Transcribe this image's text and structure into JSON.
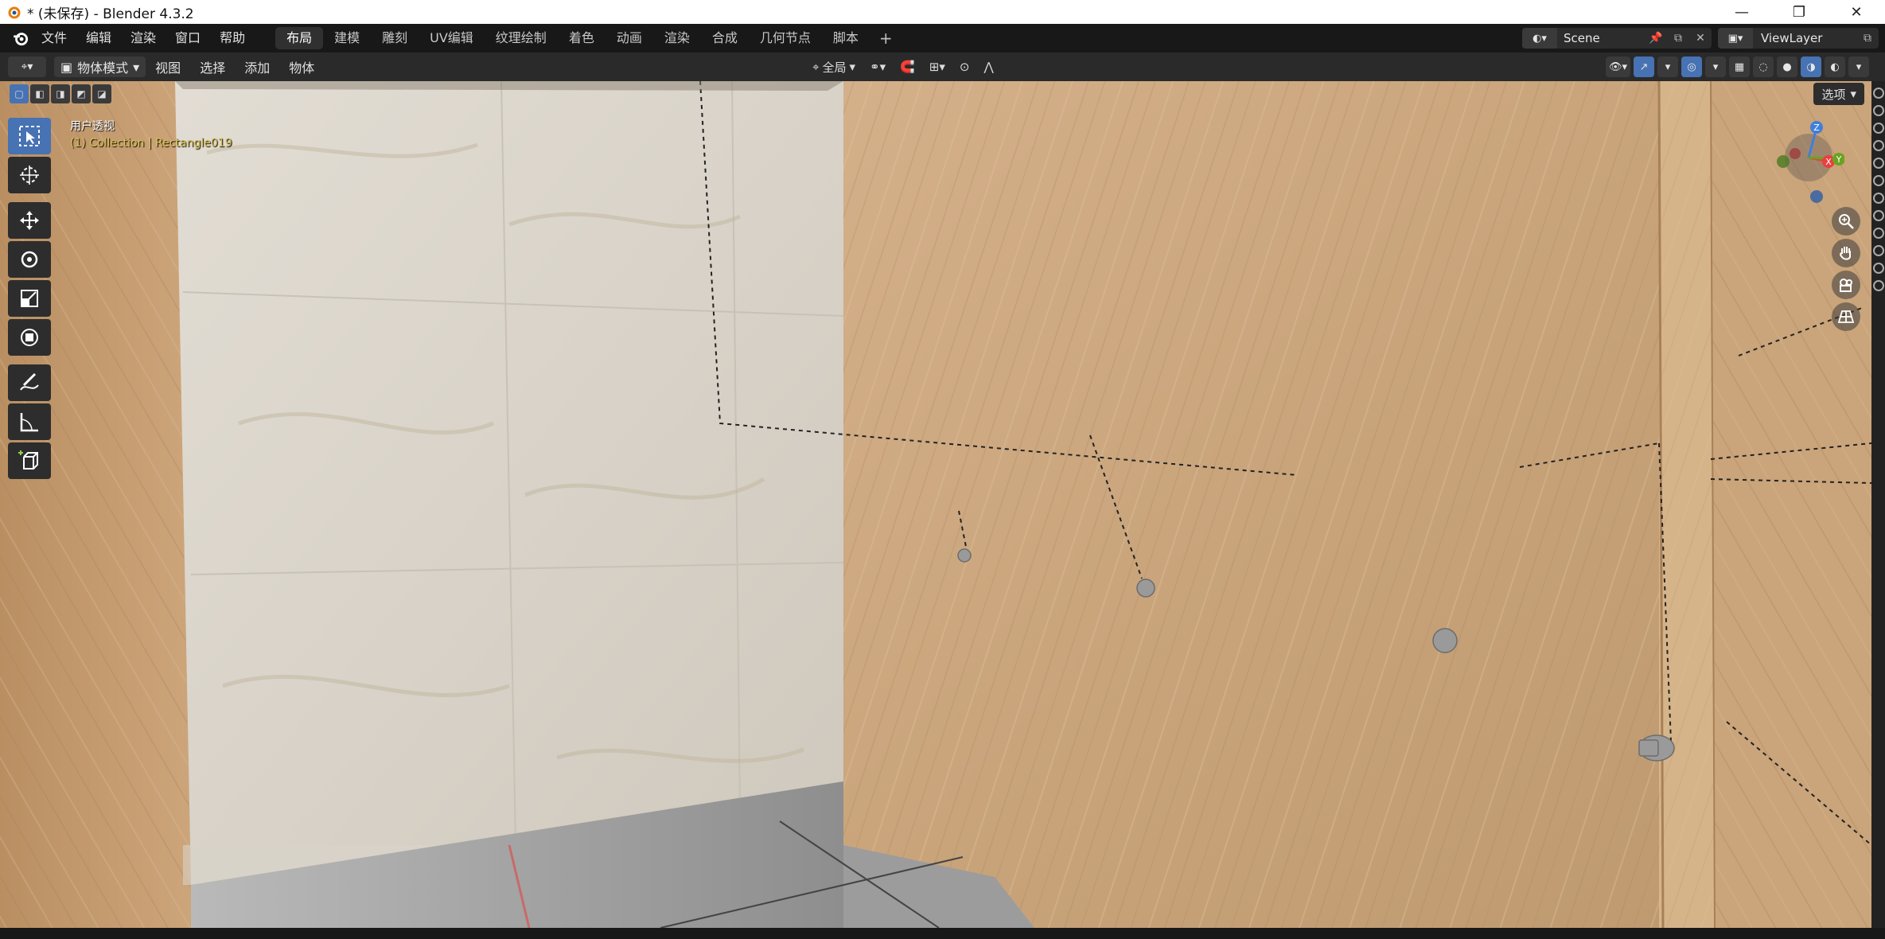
{
  "window": {
    "title": "* (未保存) - Blender 4.3.2",
    "controls": [
      "minimize",
      "restore",
      "close"
    ]
  },
  "menubar": {
    "items": [
      "文件",
      "编辑",
      "渲染",
      "窗口",
      "帮助"
    ],
    "workspaces": [
      "布局",
      "建模",
      "雕刻",
      "UV编辑",
      "纹理绘制",
      "着色",
      "动画",
      "渲染",
      "合成",
      "几何节点",
      "脚本"
    ],
    "active_workspace": "布局",
    "add_label": "+",
    "scene_name": "Scene",
    "view_layer_name": "ViewLayer"
  },
  "viewport_header": {
    "mode": "物体模式",
    "menus": [
      "视图",
      "选择",
      "添加",
      "物体"
    ],
    "transform_orientation": "全局",
    "options_label": "选项"
  },
  "viewport": {
    "view_name": "用户透视",
    "collection_info": "(1) Collection | Rectangle019"
  },
  "toolbar": {
    "tools": [
      "select-box",
      "cursor",
      "move",
      "rotate",
      "scale",
      "transform",
      "annotate",
      "measure",
      "add-cube"
    ],
    "active": "select-box"
  },
  "gizmo": {
    "axes": [
      "Z",
      "X",
      "Y"
    ],
    "colors": {
      "x": "#e8413d",
      "y": "#6aa320",
      "z": "#3f7fd9"
    }
  },
  "colors": {
    "accent": "#4772b3",
    "wood": "#c9a47b",
    "marble": "#dcd6cc"
  }
}
